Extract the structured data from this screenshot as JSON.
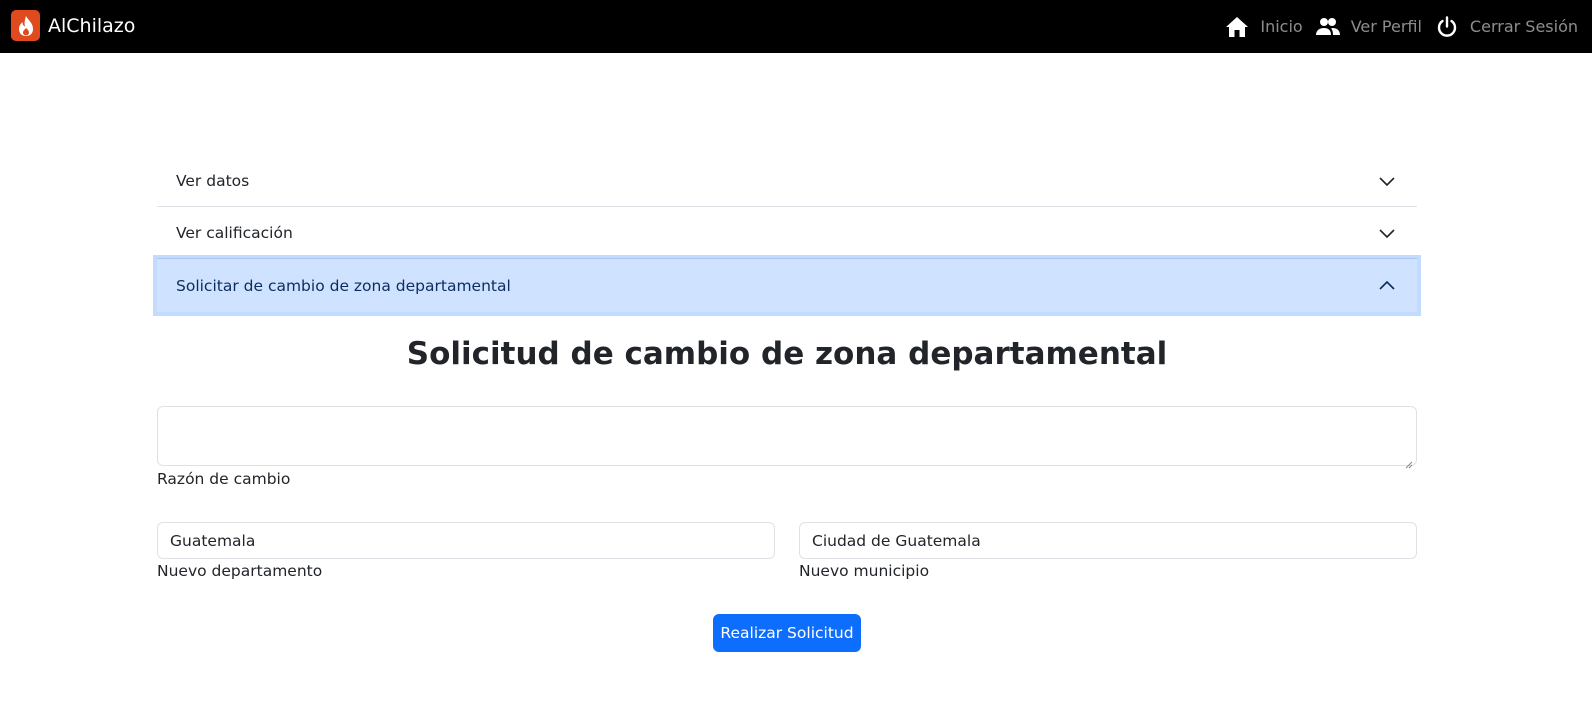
{
  "navbar": {
    "brand_name": "AlChilazo",
    "links": [
      {
        "label": "Inicio",
        "icon": "home-icon"
      },
      {
        "label": "Ver Perfil",
        "icon": "users-icon"
      },
      {
        "label": "Cerrar Sesión",
        "icon": "power-icon"
      }
    ]
  },
  "accordion": {
    "items": [
      {
        "label": "Ver datos",
        "expanded": false
      },
      {
        "label": "Ver calificación",
        "expanded": false
      },
      {
        "label": "Solicitar de cambio de zona departamental",
        "expanded": true
      }
    ]
  },
  "form": {
    "title": "Solicitud de cambio de zona departamental",
    "reason_value": "",
    "reason_label": "Razón de cambio",
    "department_value": "Guatemala",
    "department_label": "Nuevo departamento",
    "municipality_value": "Ciudad de Guatemala",
    "municipality_label": "Nuevo municipio",
    "submit_label": "Realizar Solicitud"
  },
  "colors": {
    "navbar_bg": "#000000",
    "brand_logo": "#e04a1f",
    "accordion_active_bg": "#cfe2ff",
    "primary": "#0d6efd"
  }
}
